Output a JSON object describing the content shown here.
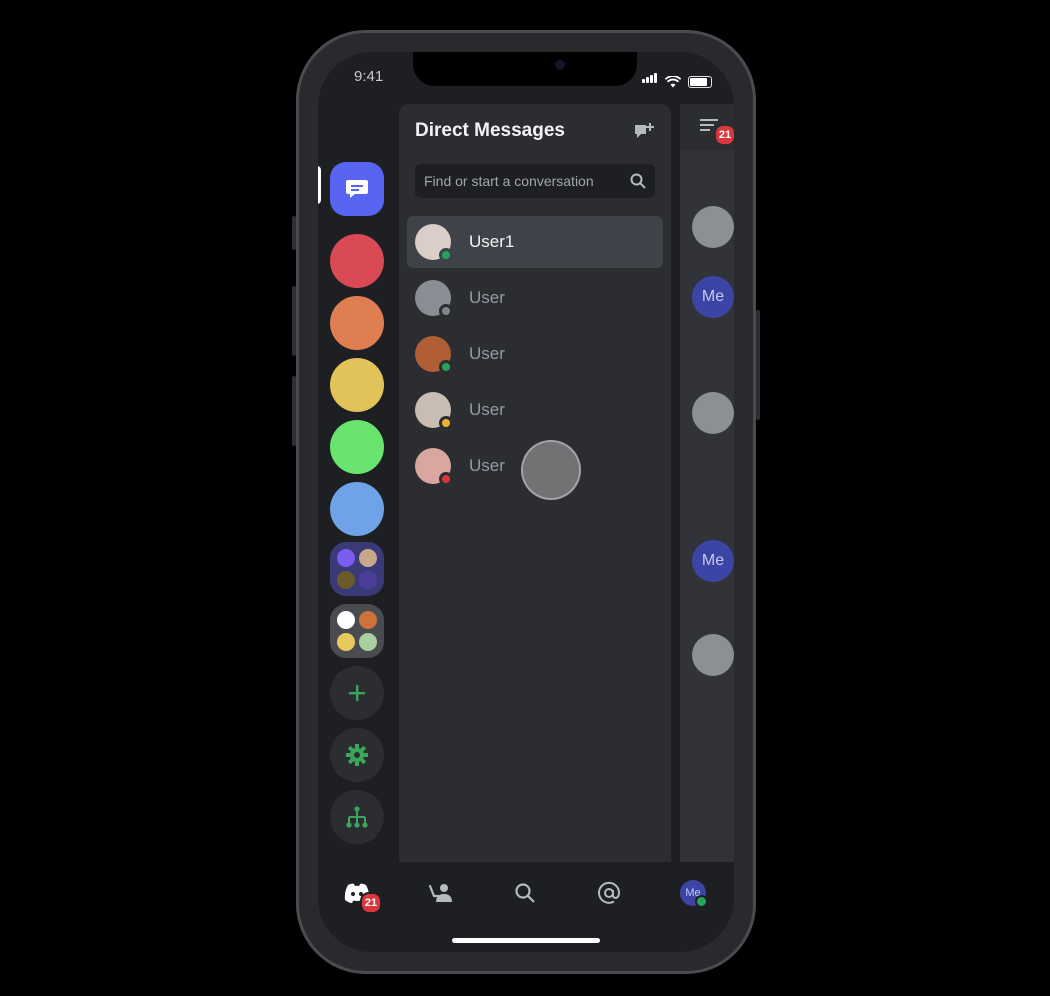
{
  "status_bar": {
    "time": "9:41"
  },
  "rail": {
    "dm_icon": "chat-bubble-icon",
    "servers": [
      {
        "name": "server-red",
        "color": "#d94a55"
      },
      {
        "name": "server-orange",
        "color": "#df7f51"
      },
      {
        "name": "server-yellow",
        "color": "#e2c35a"
      },
      {
        "name": "server-green",
        "color": "#69e56f"
      },
      {
        "name": "server-blue",
        "color": "#6fa2e6"
      }
    ],
    "folders": [
      {
        "bg": "#3b3a78",
        "dots": [
          "#7a5cf0",
          "#c7a88c",
          "#6b5a2c",
          "#4b3d9a"
        ]
      },
      {
        "bg": "#4a4b50",
        "dots": [
          "#ffffff",
          "#cc733c",
          "#e7c85b",
          "#a8cfa2"
        ]
      }
    ],
    "add_icon": "plus-icon",
    "settings_icon": "gear-icon",
    "hierarchy_icon": "hierarchy-icon"
  },
  "dm_panel": {
    "title": "Direct Messages",
    "search_placeholder": "Find or start a conversation",
    "conversations": [
      {
        "name": "User1",
        "status": "online",
        "status_color": "#23a55a",
        "avatar": "#d9cfc8",
        "active": true
      },
      {
        "name": "User",
        "status": "offline",
        "status_color": "#80848e",
        "avatar": "#8a8d93",
        "active": false
      },
      {
        "name": "User",
        "status": "online",
        "status_color": "#23a55a",
        "avatar": "#b05e36",
        "active": false
      },
      {
        "name": "User",
        "status": "idle",
        "status_color": "#f0b232",
        "avatar": "#c9bdb3",
        "active": false
      },
      {
        "name": "User",
        "status": "dnd",
        "status_color": "#da373c",
        "avatar": "#d8a8a0",
        "active": false
      }
    ]
  },
  "chat_peek": {
    "mention_count": "21",
    "me_label": "Me"
  },
  "tab_bar": {
    "home_badge": "21",
    "avatar_label": "Me"
  }
}
